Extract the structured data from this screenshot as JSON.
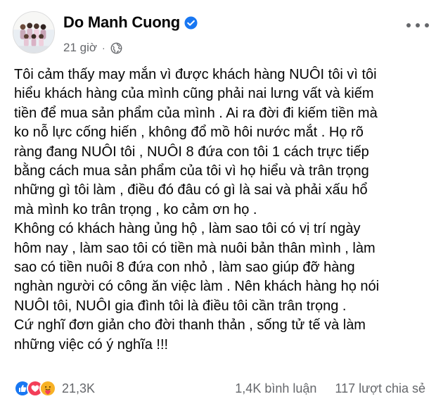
{
  "post": {
    "author": "Do Manh Cuong",
    "time": "21 giờ",
    "separator": "·",
    "body_lines": [
      "Tôi cảm thấy may mắn vì được khách hàng NUÔI tôi vì tôi",
      "hiểu khách hàng của mình cũng phải nai lưng vất và kiếm",
      "tiền để mua sản phẩm của mình . Ai ra đời đi kiếm tiền mà",
      "ko nỗ lực cống hiến , không đổ mồ hôi nước mắt . Họ rõ",
      "ràng đang NUÔI tôi , NUÔI 8 đứa con tôi 1 cách trực tiếp",
      "bằng cách mua sản phẩm của tôi vì họ hiểu và trân trọng",
      "những gì tôi làm , điều đó đâu có gì là sai và phải xấu hổ",
      "mà mình ko trân trọng , ko cảm ơn họ .",
      "Không có khách hàng ủng hộ , làm sao tôi có vị trí ngày",
      "hôm nay , làm sao tôi có tiền mà nuôi bản thân mình , làm",
      "sao có tiền nuôi 8 đứa con nhỏ , làm sao giúp đỡ hàng",
      "nghàn người có công ăn việc làm . Nên khách hàng họ nói",
      "NUÔI tôi, NUÔI gia đình tôi là điều tôi cần trân trọng .",
      "Cứ nghĩ đơn giản cho đời thanh thản , sống tử tế và làm",
      "những việc có ý nghĩa !!!"
    ]
  },
  "engagement": {
    "reaction_count": "21,3K",
    "comments": "1,4K bình luận",
    "shares": "117 lượt chia sẻ"
  },
  "icons": {
    "verified": "verified-badge-icon",
    "audience": "globe-icon",
    "more": "more-options-icon",
    "reactions": [
      "like-reaction-icon",
      "love-reaction-icon",
      "care-reaction-icon"
    ]
  },
  "colors": {
    "verified": "#1877f2",
    "like": "#1877f2",
    "love": "#f33e58",
    "care": "#f7b125",
    "secondary_text": "#65676b"
  }
}
